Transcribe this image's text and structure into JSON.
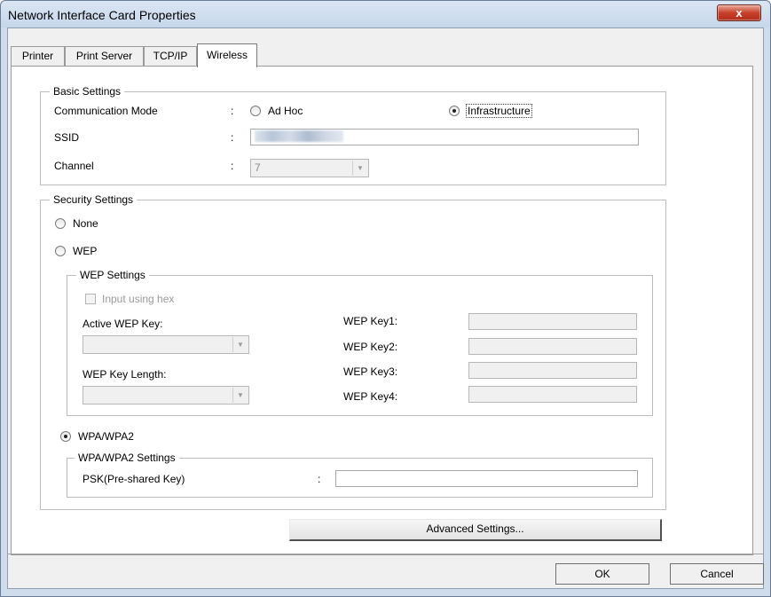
{
  "window": {
    "title": "Network Interface Card Properties",
    "close_label": "x"
  },
  "tabs": [
    {
      "label": "Printer"
    },
    {
      "label": "Print Server"
    },
    {
      "label": "TCP/IP"
    },
    {
      "label": "Wireless"
    }
  ],
  "basic": {
    "title": "Basic Settings",
    "comm_mode_label": "Communication Mode",
    "colon": ":",
    "adhoc_label": "Ad Hoc",
    "infra_label": "Infrastructure",
    "ssid_label": "SSID",
    "channel_label": "Channel",
    "channel_value": "7",
    "selected_mode": "Infrastructure"
  },
  "security": {
    "title": "Security Settings",
    "none_label": "None",
    "wep_label": "WEP",
    "wpa_label": "WPA/WPA2",
    "selected": "WPA/WPA2"
  },
  "wep": {
    "title": "WEP Settings",
    "hex_label": "Input using hex",
    "active_key_label": "Active WEP Key:",
    "key_length_label": "WEP Key Length:",
    "key1_label": "WEP Key1:",
    "key2_label": "WEP Key2:",
    "key3_label": "WEP Key3:",
    "key4_label": "WEP Key4:"
  },
  "wpa": {
    "title": "WPA/WPA2 Settings",
    "psk_label": "PSK(Pre-shared Key)",
    "colon": ":",
    "psk_value": ""
  },
  "buttons": {
    "advanced": "Advanced Settings...",
    "ok": "OK",
    "cancel": "Cancel"
  }
}
